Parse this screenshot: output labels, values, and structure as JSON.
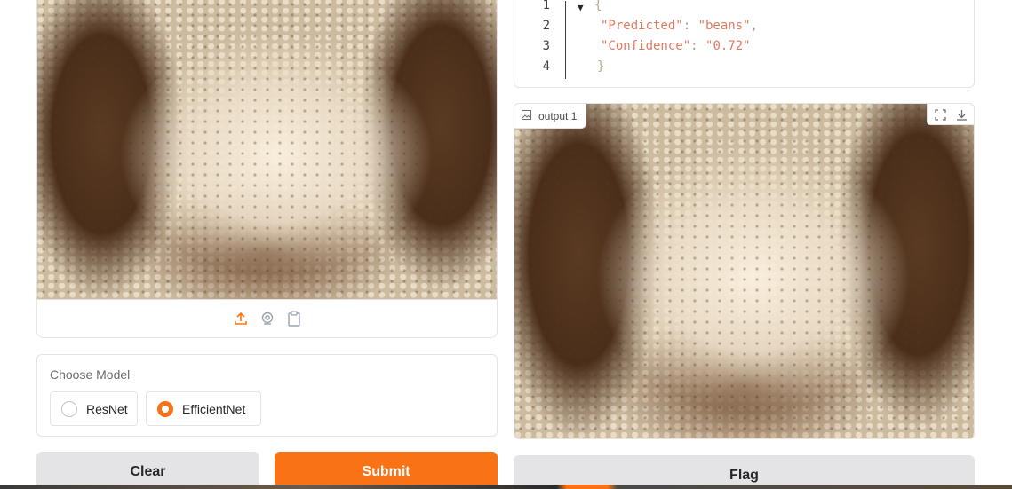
{
  "input_image": {
    "alt": "Hands holding black-eyed beans",
    "source_buttons": [
      "upload-icon",
      "webcam-icon",
      "clipboard-icon"
    ]
  },
  "model_selector": {
    "label": "Choose Model",
    "options": [
      {
        "label": "ResNet",
        "selected": false
      },
      {
        "label": "EfficientNet",
        "selected": true
      }
    ]
  },
  "buttons": {
    "clear": "Clear",
    "submit": "Submit",
    "flag": "Flag"
  },
  "json_output": {
    "line_numbers": [
      "1",
      "2",
      "3",
      "4"
    ],
    "open_brace": "{",
    "close_brace": "}",
    "entries": [
      {
        "key": "\"Predicted\"",
        "value": "\"beans\"",
        "trailing": ","
      },
      {
        "key": "\"Confidence\"",
        "value": "\"0.72\"",
        "trailing": ""
      }
    ]
  },
  "output_image": {
    "label": "output 1",
    "tools": [
      "fullscreen-icon",
      "download-icon"
    ]
  },
  "colors": {
    "accent": "#f97316",
    "border": "#e4e4e7",
    "neutral_button": "#e4e4e7"
  }
}
